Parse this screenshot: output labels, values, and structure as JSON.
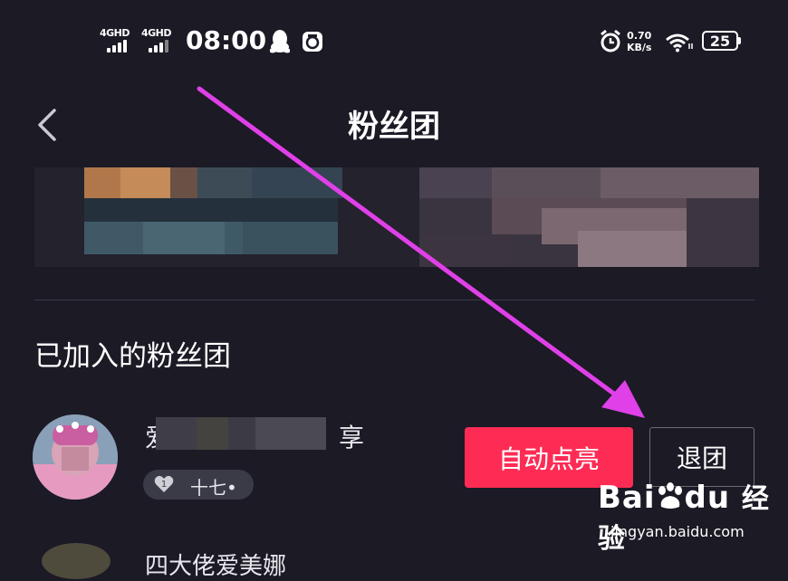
{
  "status_bar": {
    "net1": "4GHD",
    "net2": "4GHD",
    "time": "08:00",
    "speed_value": "0.70",
    "speed_unit": "KB/s",
    "battery": "25"
  },
  "header": {
    "title": "粉丝团"
  },
  "section": {
    "title": "已加入的粉丝团"
  },
  "fan_club": {
    "name_start": "爱",
    "name_end": "享",
    "badge_level": "1",
    "badge_label": "十七•",
    "auto_light_button": "自动点亮",
    "quit_button": "退团"
  },
  "next_item": {
    "name": "四大佬爱美娜"
  },
  "watermark": {
    "logo_left": "Bai",
    "logo_right": "du",
    "product": "经验",
    "url": "jingyan.baidu.com"
  },
  "colors": {
    "background": "#1b1a25",
    "accent": "#fe2c55",
    "arrow": "#e040e8"
  }
}
